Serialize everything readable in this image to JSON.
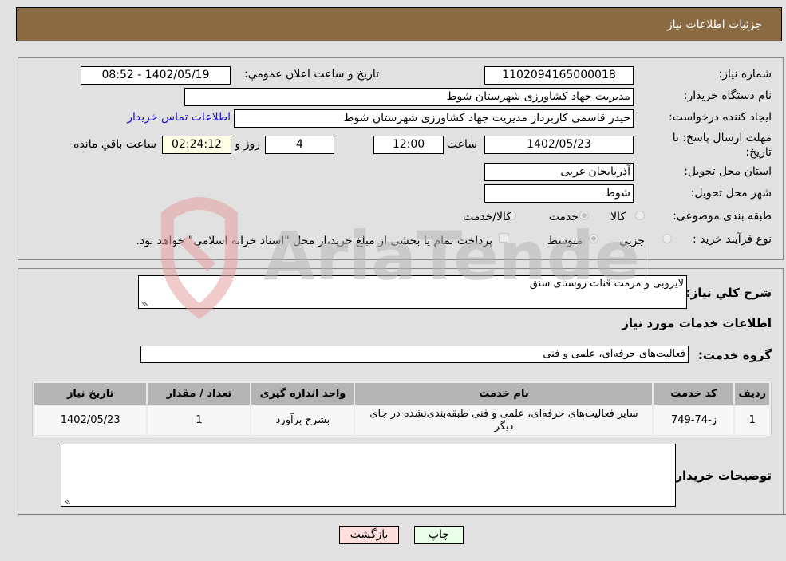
{
  "header": {
    "title": "جزئیات اطلاعات نیاز"
  },
  "form": {
    "need_number_label": "شماره نیاز:",
    "need_number": "1102094165000018",
    "announce_label": "تاریخ و ساعت اعلان عمومي:",
    "announce_value": "1402/05/19 - 08:52",
    "buyer_org_label": "نام دستگاه خريدار:",
    "buyer_org": "مدیریت جهاد کشاورزی شهرستان شوط",
    "requester_label": "ايجاد کننده درخواست:",
    "requester": "حیدر قاسمی کاربرداز مدیریت جهاد کشاورزی شهرستان شوط",
    "buyer_contact_link": "اطلاعات تماس خریدار",
    "deadline_label": "مهلت ارسال پاسخ: تا تاریخ:",
    "deadline_date": "1402/05/23",
    "time_label": "ساعت",
    "deadline_time": "12:00",
    "days_value": "4",
    "days_label": "روز و",
    "remaining_time": "02:24:12",
    "remaining_label": "ساعت باقي مانده",
    "province_label": "استان محل تحویل:",
    "province": "آذربایجان غربی",
    "city_label": "شهر محل تحویل:",
    "city": "شوط",
    "category_label": "طبقه بندی موضوعی:",
    "category_options": [
      {
        "label": "کالا",
        "selected": false
      },
      {
        "label": "خدمت",
        "selected": true
      },
      {
        "label": "کالا/خدمت",
        "selected": false
      }
    ],
    "purchase_type_label": "نوع فرآیند خرید :",
    "purchase_options": [
      {
        "label": "جزيي",
        "selected": false
      },
      {
        "label": "متوسط",
        "selected": true
      }
    ],
    "treasury_note": "پرداخت تمام یا بخشی از مبلغ خرید،از محل \"اسناد خزانه اسلامی\" خواهد بود.",
    "treasury_checked": false
  },
  "details": {
    "general_desc_label": "شرح کلي نياز:",
    "general_desc": "لایروبی و مرمت قنات روستای سنق",
    "services_info_title": "اطلاعات خدمات مورد نياز",
    "service_group_label": "گروه خدمت:",
    "service_group": "فعالیت‌های حرفه‌ای، علمی و فنی",
    "table": {
      "headers": [
        "ردیف",
        "کد خدمت",
        "نام خدمت",
        "واحد اندازه گیری",
        "تعداد / مقدار",
        "تاریخ نیاز"
      ],
      "rows": [
        [
          "1",
          "ز-74-749",
          "سایر فعالیت‌های حرفه‌ای، علمی و فنی طبقه‌بندی‌نشده در جای دیگر",
          "بشرح برآورد",
          "1",
          "1402/05/23"
        ]
      ]
    },
    "buyer_notes_label": "توضیحات خریدار:",
    "buyer_notes": ""
  },
  "buttons": {
    "print": "چاپ",
    "back": "بازگشت"
  },
  "colors": {
    "header_bg": "#8b6b43",
    "print_bg": "#eaffea",
    "back_bg": "#ffdede",
    "link": "#1a10d2"
  },
  "watermark": {
    "text": "AriaTender.neT"
  }
}
